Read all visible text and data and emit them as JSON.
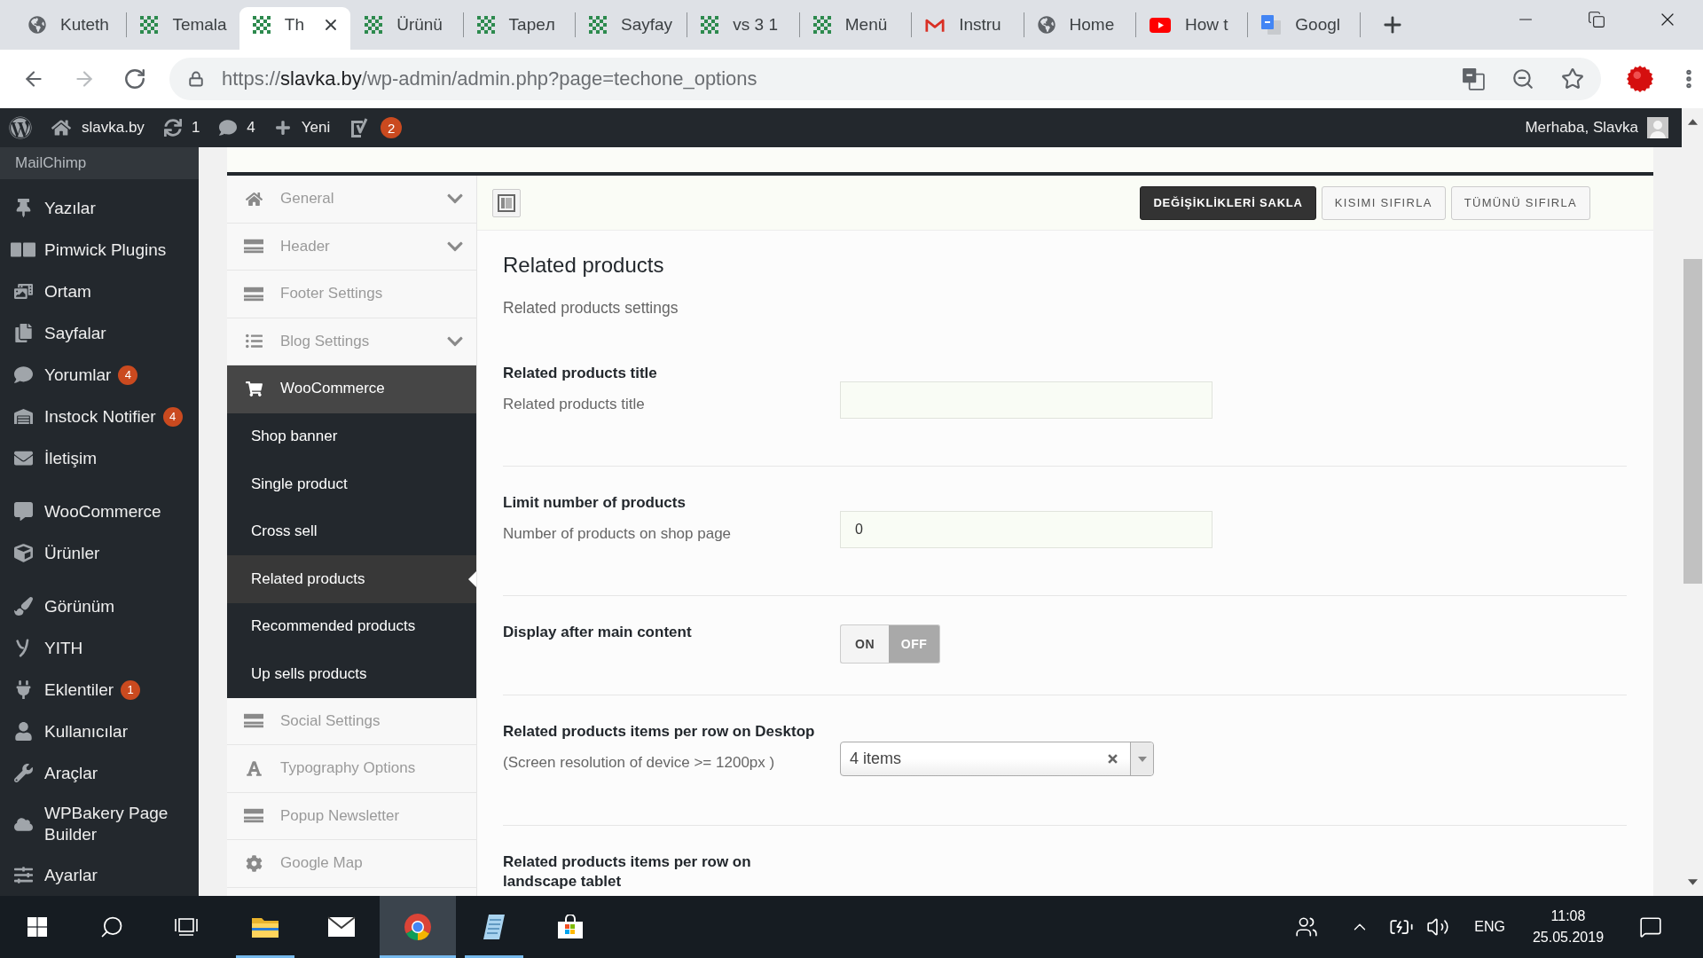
{
  "browser": {
    "tabs": [
      {
        "title": "Kuteth",
        "selected": false
      },
      {
        "title": "Temala",
        "selected": false
      },
      {
        "title": "Th",
        "selected": true
      },
      {
        "title": "Ürünü",
        "selected": false
      },
      {
        "title": "Tapeл",
        "selected": false
      },
      {
        "title": "Sayfay",
        "selected": false
      },
      {
        "title": "vs 3 1",
        "selected": false
      },
      {
        "title": "Menü",
        "selected": false
      },
      {
        "title": "Instru",
        "selected": false
      },
      {
        "title": "Home",
        "selected": false
      },
      {
        "title": "How t",
        "selected": false
      },
      {
        "title": "Googl",
        "selected": false
      }
    ],
    "url": {
      "scheme": "https://",
      "host": "slavka.by",
      "path": "/wp-admin/admin.php?page=techone_options"
    }
  },
  "admin_bar": {
    "site": "slavka.by",
    "updates": "1",
    "comments": "4",
    "new_label": "Yeni",
    "seo_count": "2",
    "greeting": "Merhaba, Slavka"
  },
  "admin_menu": {
    "submenu": [
      {
        "label": "MailChimp",
        "selected": false
      }
    ],
    "groups": [
      {
        "items": [
          {
            "label": "Yazılar",
            "selected": false
          },
          {
            "label": "Pimwick Plugins",
            "selected": false
          },
          {
            "label": "Ortam",
            "selected": false
          },
          {
            "label": "Sayfalar",
            "selected": false
          },
          {
            "label": "Yorumlar",
            "badge": "4",
            "selected": false
          },
          {
            "label": "Instock Notifier",
            "badge": "4",
            "selected": false
          },
          {
            "label": "İletişim",
            "selected": false
          }
        ]
      },
      {
        "items": [
          {
            "label": "WooCommerce",
            "selected": false
          },
          {
            "label": "Ürünler",
            "selected": false
          }
        ]
      },
      {
        "items": [
          {
            "label": "Görünüm",
            "selected": false
          },
          {
            "label": "YITH",
            "selected": false
          },
          {
            "label": "Eklentiler",
            "badge": "1",
            "selected": false
          },
          {
            "label": "Kullanıcılar",
            "selected": false
          },
          {
            "label": "Araçlar",
            "selected": false
          },
          {
            "label": "WPBakery Page Builder",
            "selected": false
          },
          {
            "label": "Ayarlar",
            "selected": false
          }
        ]
      }
    ]
  },
  "options": {
    "toolbar": {
      "buttons": [
        {
          "label": "DEĞİŞİKLİKLERİ SAKLA",
          "kind": "primary"
        },
        {
          "label": "KISIMI SIFIRLA",
          "kind": "secondary"
        },
        {
          "label": "TÜMÜNÜ SIFIRLA",
          "kind": "secondary"
        }
      ]
    },
    "nav": [
      {
        "label": "General",
        "selected": false,
        "expanded": false
      },
      {
        "label": "Header",
        "selected": false,
        "expanded": false
      },
      {
        "label": "Footer Settings",
        "selected": false
      },
      {
        "label": "Blog Settings",
        "selected": false,
        "expanded": false
      },
      {
        "label": "WooCommerce",
        "selected": false,
        "expanded": true,
        "children": [
          {
            "label": "Shop banner",
            "selected": false
          },
          {
            "label": "Single product",
            "selected": false
          },
          {
            "label": "Cross sell",
            "selected": false
          },
          {
            "label": "Related products",
            "selected": true
          },
          {
            "label": "Recommended products",
            "selected": false
          },
          {
            "label": "Up sells products",
            "selected": false
          }
        ]
      },
      {
        "label": "Social Settings",
        "selected": false
      },
      {
        "label": "Typography Options",
        "selected": false
      },
      {
        "label": "Popup Newsletter",
        "selected": false
      },
      {
        "label": "Google Map",
        "selected": false
      }
    ],
    "section": {
      "title": "Related products",
      "description": "Related products settings",
      "fields": [
        {
          "kind": "text",
          "label": "Related products title",
          "description": "Related products title"
        },
        {
          "kind": "text",
          "label": "Limit number of products",
          "description": "Number of products on shop page",
          "value": "0"
        },
        {
          "kind": "toggle",
          "label": "Display after main content",
          "on": false,
          "on_label": "ON",
          "off_label": "OFF"
        },
        {
          "kind": "select",
          "label": "Related products items per row on Desktop",
          "description": "(Screen resolution of device >= 1200px )",
          "value": "4 items"
        },
        {
          "label": "Related products items per row on landscape tablet"
        }
      ]
    }
  },
  "taskbar": {
    "apps": [
      {
        "running": true,
        "selected": false
      },
      {
        "running": false,
        "selected": false
      },
      {
        "running": true,
        "selected": true
      },
      {
        "running": true,
        "selected": false
      },
      {
        "running": false,
        "selected": false
      }
    ],
    "language": "ENG",
    "time": "11:08",
    "date": "25.05.2019"
  }
}
